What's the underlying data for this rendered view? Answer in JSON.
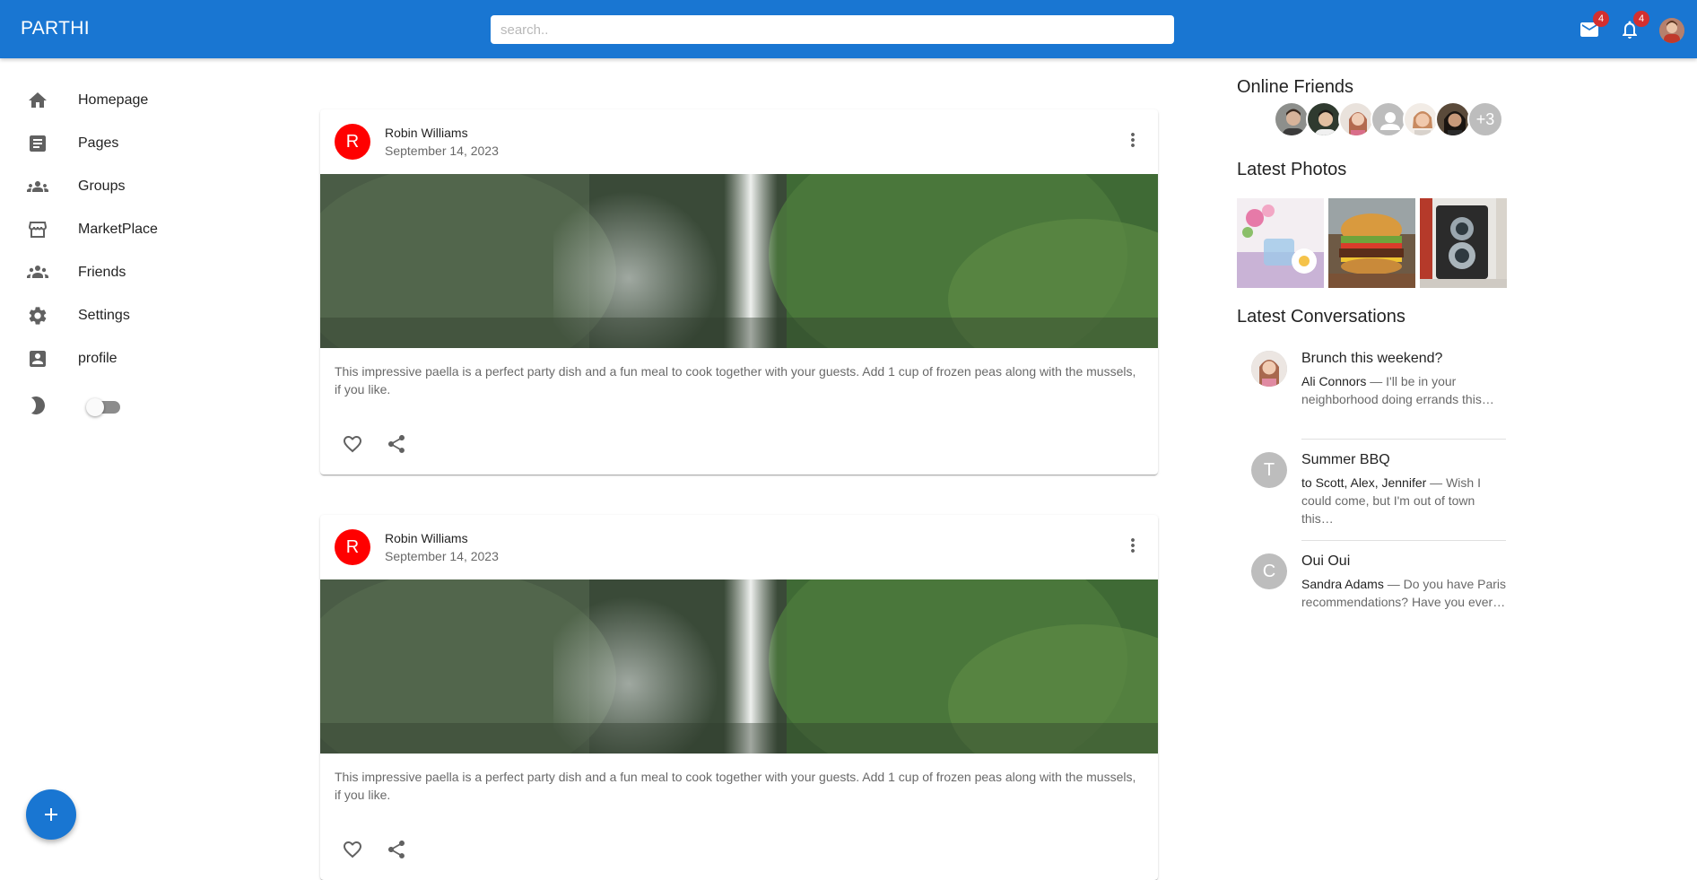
{
  "app": {
    "title": "PARTHI"
  },
  "search": {
    "placeholder": "search.."
  },
  "header": {
    "mail_badge": "4",
    "notifications_badge": "4"
  },
  "sidebar": {
    "items": [
      {
        "label": "Homepage",
        "icon": "home-icon"
      },
      {
        "label": "Pages",
        "icon": "article-icon"
      },
      {
        "label": "Groups",
        "icon": "groups-icon"
      },
      {
        "label": "MarketPlace",
        "icon": "storefront-icon"
      },
      {
        "label": "Friends",
        "icon": "people-icon"
      },
      {
        "label": "Settings",
        "icon": "gear-icon"
      },
      {
        "label": "profile",
        "icon": "account-box-icon"
      }
    ],
    "dark_mode_enabled": false
  },
  "posts": [
    {
      "avatar_letter": "R",
      "author": "Robin Williams",
      "date": "September 14, 2023",
      "text": "This impressive paella is a perfect party dish and a fun meal to cook together with your guests. Add 1 cup of frozen peas along with the mussels, if you like."
    },
    {
      "avatar_letter": "R",
      "author": "Robin Williams",
      "date": "September 14, 2023",
      "text": "This impressive paella is a perfect party dish and a fun meal to cook together with your guests. Add 1 cup of frozen peas along with the mussels, if you like."
    }
  ],
  "right": {
    "online_title": "Online Friends",
    "online_more": "+3",
    "photos_title": "Latest Photos",
    "conversations_title": "Latest Conversations",
    "conversations": [
      {
        "avatar": "",
        "title": "Brunch this weekend?",
        "from": "Ali Connors",
        "snippet": " — I'll be in your neighborhood doing errands this…"
      },
      {
        "avatar": "T",
        "title": "Summer BBQ",
        "from": "to Scott, Alex, Jennifer",
        "snippet": " — Wish I could come, but I'm out of town this…"
      },
      {
        "avatar": "C",
        "title": "Oui Oui",
        "from": "Sandra Adams",
        "snippet": " — Do you have Paris recommendations? Have you ever…"
      }
    ]
  },
  "colors": {
    "primary": "#1976d2",
    "badge": "#d32f2f",
    "post_avatar": "#ff0000"
  }
}
